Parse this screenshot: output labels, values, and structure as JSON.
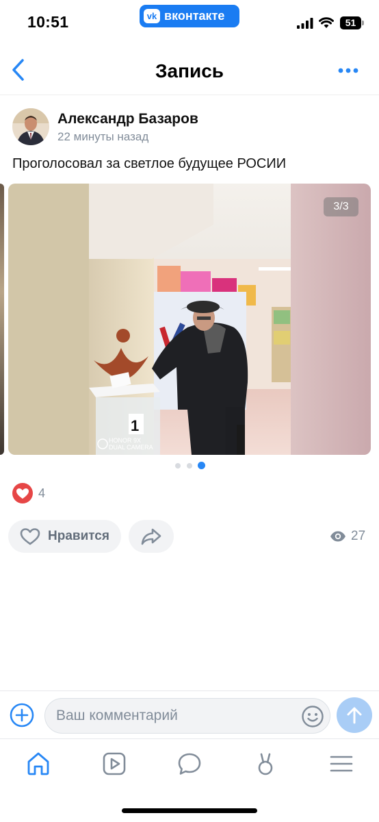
{
  "status_bar": {
    "time": "10:51",
    "app_pill_label": "вконтакте",
    "app_pill_logo": "vk",
    "battery": "51",
    "icons": [
      "signal-icon",
      "wifi-icon",
      "battery-icon"
    ]
  },
  "header": {
    "title": "Запись",
    "left_icon": "back-chevron-icon",
    "right_icon": "more-dots-icon"
  },
  "post": {
    "author": "Александр Базаров",
    "time": "22 минуты назад",
    "text": "Проголосовал за светлое будущее РОСИИ",
    "photo_counter": "3/3",
    "photo_watermark_line1": "HONOR 9X",
    "photo_watermark_line2": "DUAL CAMERA",
    "ballot_box_number": "1",
    "carousel_page_count": 3,
    "carousel_active_index": 2,
    "reactions_count": "4",
    "like_label": "Нравится",
    "views_count": "27"
  },
  "comment_bar": {
    "placeholder": "Ваш комментарий"
  },
  "tab_bar": {
    "items": [
      "home-icon",
      "video-icon",
      "messages-icon",
      "clips-icon",
      "menu-icon"
    ],
    "active": "home-icon"
  },
  "colors": {
    "accent": "#2787f5",
    "vk_blue": "#1a7cf2",
    "reaction_red": "#e64646",
    "muted_text": "#818c99",
    "send_disabled": "#a9cdf6"
  }
}
